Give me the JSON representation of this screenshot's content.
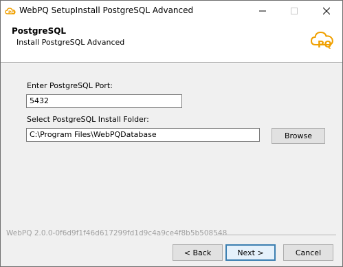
{
  "window": {
    "title": "WebPQ SetupInstall PostgreSQL Advanced",
    "minimize_label": "Minimize",
    "maximize_label": "Maximize",
    "close_label": "Close"
  },
  "header": {
    "title": "PostgreSQL",
    "subtitle": "Install PostgreSQL Advanced",
    "logo_text": "PQ"
  },
  "form": {
    "port_label": "Enter PostgreSQL Port:",
    "port_value": "5432",
    "folder_label": "Select PostgreSQL Install Folder:",
    "folder_value": "C:\\Program Files\\WebPQDatabase",
    "browse_label": "Browse"
  },
  "footer": {
    "version": "WebPQ 2.0.0-0f6d9f1f46d617299fd1d9c4a9ce4f8b5b508548",
    "back_label": "< Back",
    "next_label": "Next >",
    "cancel_label": "Cancel"
  },
  "colors": {
    "accent": "#f0a000",
    "default_button_border": "#3c7fb1"
  }
}
